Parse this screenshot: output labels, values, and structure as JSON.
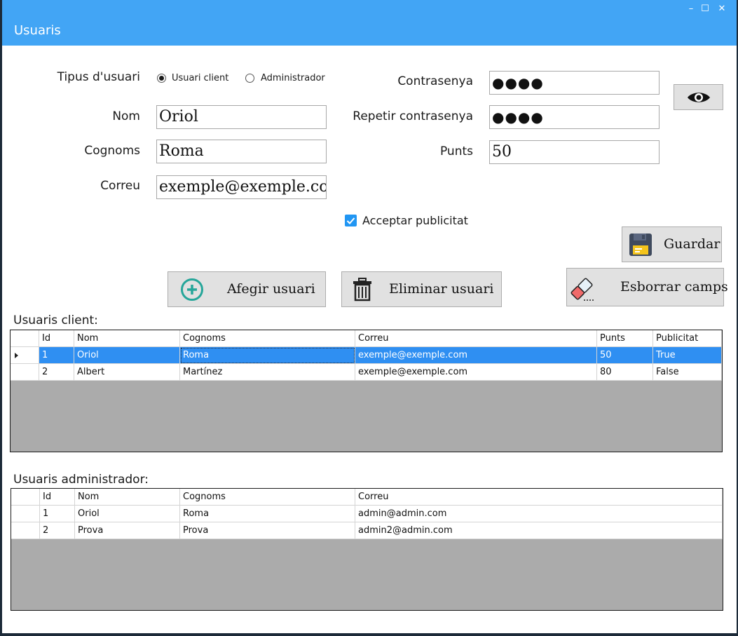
{
  "window": {
    "title": "Usuaris",
    "controls": [
      "–",
      "☐",
      "✕"
    ]
  },
  "form": {
    "user_type_label": "Tipus d'usuari",
    "radio_client": "Usuari client",
    "radio_admin": "Administrador",
    "selected_type": "client",
    "nom_label": "Nom",
    "nom_value": "Oriol",
    "cognoms_label": "Cognoms",
    "cognoms_value": "Roma",
    "correu_label": "Correu",
    "correu_value": "exemple@exemple.co",
    "password_label": "Contrasenya",
    "password_value": "●●●●",
    "repeat_label": "Repetir contrasenya",
    "repeat_value": "●●●●",
    "punts_label": "Punts",
    "punts_value": "50",
    "publicitat_label": "Acceptar publicitat",
    "publicitat_checked": true
  },
  "buttons": {
    "show_password_icon": "eye-icon",
    "save": "Guardar",
    "save_icon": "floppy-disk-icon",
    "add": "Afegir usuari",
    "add_icon": "plus-circle-icon",
    "delete": "Eliminar usuari",
    "delete_icon": "trash-icon",
    "clear": "Esborrar camps",
    "clear_icon": "eraser-icon"
  },
  "client_table": {
    "title": "Usuaris client:",
    "columns": [
      "Id",
      "Nom",
      "Cognoms",
      "Correu",
      "Punts",
      "Publicitat"
    ],
    "rows": [
      [
        "1",
        "Oriol",
        "Roma",
        "exemple@exemple.com",
        "50",
        "True"
      ],
      [
        "2",
        "Albert",
        "Martínez",
        "exemple@exemple.com",
        "80",
        "False"
      ]
    ],
    "selected_row": 0
  },
  "admin_table": {
    "title": "Usuaris administrador:",
    "columns": [
      "Id",
      "Nom",
      "Cognoms",
      "Correu"
    ],
    "rows": [
      [
        "1",
        "Oriol",
        "Roma",
        "admin@admin.com"
      ],
      [
        "2",
        "Prova",
        "Prova",
        "admin2@admin.com"
      ]
    ]
  },
  "colors": {
    "titlebar": "#42a5f5",
    "selection": "#2f8ff2",
    "grid_background": "#ababab",
    "check_accent": "#2196f3"
  }
}
